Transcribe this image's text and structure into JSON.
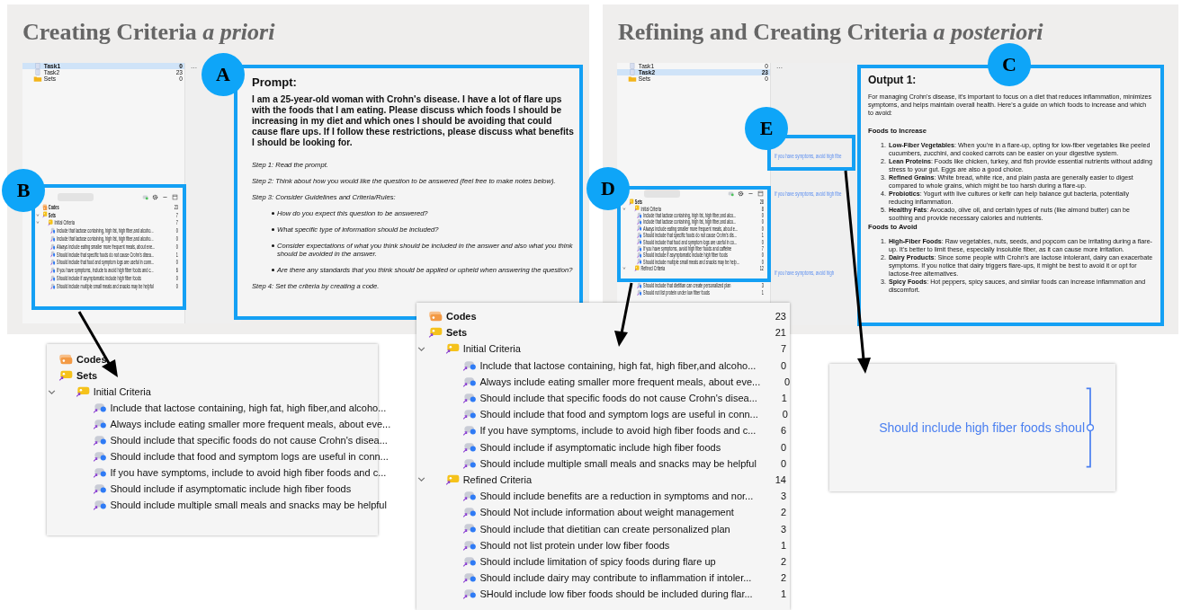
{
  "left_panel": {
    "title": "Creating Criteria *a priori*",
    "document_tree": [
      {
        "label": "Task1",
        "count": "0",
        "kind": "doc",
        "selected": true
      },
      {
        "label": "Task2",
        "count": "23",
        "kind": "doc",
        "selected": false
      },
      {
        "label": "Sets",
        "count": "0",
        "kind": "folder",
        "selected": false
      }
    ],
    "more_glyph": "···",
    "code_system": {
      "callout": "B",
      "rows": [
        {
          "label": "Codes",
          "count": "23",
          "kind": "codes"
        },
        {
          "label": "Sets",
          "count": "7",
          "kind": "set",
          "expanded": true,
          "children": [
            {
              "label": "Initial Criteria",
              "count": "7",
              "kind": "set",
              "expanded": true,
              "children": [
                {
                  "label": "Include that lactose containing, high fat, high fiber,and alcoho...",
                  "count": "0",
                  "kind": "code"
                },
                {
                  "label": "Include that lactose containing, high fat, high fiber,and alcoho...",
                  "count": "0",
                  "kind": "code"
                },
                {
                  "label": "Always include eating smaller more frequent meals, about eve...",
                  "count": "0",
                  "kind": "code"
                },
                {
                  "label": "Should include that specific foods do not cause Crohn's disea...",
                  "count": "1",
                  "kind": "code"
                },
                {
                  "label": "Should include that food and symptom logs are useful in conn...",
                  "count": "0",
                  "kind": "code"
                },
                {
                  "label": "If you have symptoms, include to avoid high fiber foods and c...",
                  "count": "6",
                  "kind": "code"
                },
                {
                  "label": "Should include if asymptomatic include high fiber foods",
                  "count": "0",
                  "kind": "code"
                },
                {
                  "label": "Should include multiple small meals and snacks may be helpful",
                  "count": "0",
                  "kind": "code"
                }
              ]
            }
          ]
        }
      ]
    },
    "prompt": {
      "callout": "A",
      "heading": "Prompt:",
      "question": "I am a 25-year-old woman with Crohn's disease.  I have a lot of flare ups with the foods that I am eating.  Please discuss which foods I should be increasing in my diet and which ones I should be avoiding that could cause flare ups. If I follow these restrictions, please discuss what benefits I should be looking for.",
      "steps": [
        {
          "text": "Step 1: Read the prompt."
        },
        {
          "text": "Step 2: Think about how you would like the question to be answered (feel free to make notes below)."
        },
        {
          "text": "Step 3: Consider Guidelines and Criteria/Rules:",
          "bullets": [
            "How do you expect this question to be answered?",
            "What specific type of information should be included?",
            "Consider expectations of what you think should be included in the answer and also what you think should be avoided in the answer.",
            "Are there any standards that you think should be applied or upheld when answering the question?"
          ]
        },
        {
          "text": "Step 4: Set the criteria by creating a code."
        }
      ]
    }
  },
  "right_panel": {
    "title": "Refining and Creating Criteria *a posteriori*",
    "document_tree": [
      {
        "label": "Task1",
        "count": "0",
        "kind": "doc",
        "selected": false
      },
      {
        "label": "Task2",
        "count": "23",
        "kind": "doc",
        "selected": true
      },
      {
        "label": "Sets",
        "count": "0",
        "kind": "folder",
        "selected": false
      }
    ],
    "more_glyph": "···",
    "code_system": {
      "callout": "D",
      "rows": [
        {
          "label": "Sets",
          "count": "28",
          "kind": "set",
          "children": [
            {
              "label": "Initial Criteria",
              "count": "8",
              "kind": "set",
              "expanded": true,
              "children": [
                {
                  "label": "Include that lactose containing, high fat, high fiber,and alco...",
                  "count": "0",
                  "kind": "code"
                },
                {
                  "label": "Include that lactose containing, high fat, high fiber,and alco...",
                  "count": "0",
                  "kind": "code"
                },
                {
                  "label": "Always include eating smaller more frequent meals, about e...",
                  "count": "0",
                  "kind": "code"
                },
                {
                  "label": "Should include that specific foods do not cause Crohn's dis...",
                  "count": "1",
                  "kind": "code"
                },
                {
                  "label": "Should include that food and symptom logs are useful in co...",
                  "count": "0",
                  "kind": "code"
                },
                {
                  "label": "If you have symptoms, avoid high fiber foods and caffeine",
                  "count": "7",
                  "kind": "code"
                },
                {
                  "label": "Should include if asymptomatic include high fiber foods",
                  "count": "0",
                  "kind": "code"
                },
                {
                  "label": "Should include multiple small meals and snacks may be help...",
                  "count": "0",
                  "kind": "code"
                }
              ]
            },
            {
              "label": "Refined Criteria",
              "count": "12",
              "kind": "set",
              "expanded": true,
              "children": [
                {
                  "label": "Should include that dietitian can create personalized plan",
                  "count": "3",
                  "kind": "code"
                },
                {
                  "label": "Should not list protein under low fiber foods",
                  "count": "1",
                  "kind": "code"
                }
              ]
            }
          ]
        }
      ]
    },
    "segment_callout": "E",
    "segments": [
      "If you have symptoms, avoid high fibe",
      "If you have symptoms, avoid high fibe",
      "If you have symptoms, avoid high"
    ],
    "output": {
      "callout": "C",
      "heading": "Output 1:",
      "intro": "For managing Crohn's disease, it's important to focus on a diet that reduces inflammation, minimizes symptoms, and helps maintain overall health. Here's a guide on which foods to increase and which to avoid:",
      "sections": [
        {
          "heading": "Foods to Increase",
          "items": [
            {
              "number": "1.",
              "text": "**Low-Fiber Vegetables**: When you're in a flare-up, opting for low-fiber vegetables like peeled cucumbers, zucchini, and cooked carrots can be easier on your digestive system."
            },
            {
              "number": "2.",
              "text": "**Lean Proteins**: Foods like chicken, turkey, and fish provide essential nutrients without adding stress to your gut. Eggs are also a good choice."
            },
            {
              "number": "3.",
              "text": "**Refined Grains**: White bread, white rice, and plain pasta are generally easier to digest compared to whole grains, which might be too harsh during a flare-up."
            },
            {
              "number": "4.",
              "text": "**Probiotics**: Yogurt with live cultures or kefir can help balance gut bacteria, potentially reducing inflammation."
            },
            {
              "number": "5.",
              "text": "**Healthy Fats**: Avocado, olive oil, and certain types of nuts (like almond butter) can be soothing and provide necessary calories and nutrients."
            }
          ]
        },
        {
          "heading": "Foods to Avoid",
          "items": [
            {
              "number": "1.",
              "text": "**High-Fiber Foods**: Raw vegetables, nuts, seeds, and popcorn can be irritating during a flare-up. It's better to limit these, especially insoluble fiber, as it can cause more irritation."
            },
            {
              "number": "2.",
              "text": "**Dairy Products**: Since some people with Crohn's are lactose intolerant, dairy can exacerbate symptoms. If you notice that dairy triggers flare-ups, it might be best to avoid it or opt for lactose-free alternatives."
            },
            {
              "number": "3.",
              "text": "**Spicy Foods**: Hot peppers, spicy sauces, and similar foods can increase inflammation and discomfort."
            }
          ]
        }
      ]
    }
  },
  "insets": {
    "b": {
      "rows": [
        {
          "label": "Codes",
          "kind": "codes"
        },
        {
          "label": "Sets",
          "kind": "set",
          "children": [
            {
              "label": "Initial Criteria",
              "kind": "set",
              "expanded": true,
              "children": [
                {
                  "label": "Include that lactose containing, high fat, high fiber,and alcoho...",
                  "kind": "code"
                },
                {
                  "label": "Always include eating smaller more frequent meals, about eve...",
                  "kind": "code"
                },
                {
                  "label": "Should include that specific foods do not cause Crohn's disea...",
                  "kind": "code"
                },
                {
                  "label": "Should include that food and symptom logs are useful in conn...",
                  "kind": "code"
                },
                {
                  "label": "If you have symptoms, include to avoid high fiber foods and c...",
                  "kind": "code"
                },
                {
                  "label": "Should include if asymptomatic include high fiber foods",
                  "kind": "code"
                },
                {
                  "label": "Should include multiple small meals and snacks may be helpful",
                  "kind": "code"
                }
              ]
            }
          ]
        }
      ]
    },
    "d": {
      "rows": [
        {
          "label": "Codes",
          "count": "23",
          "kind": "codes"
        },
        {
          "label": "Sets",
          "count": "21",
          "kind": "set",
          "children": [
            {
              "label": "Initial Criteria",
              "count": "7",
              "kind": "set",
              "expanded": true,
              "children": [
                {
                  "label": "Include that lactose containing, high fat, high fiber,and alcoho...",
                  "count": "0",
                  "kind": "code"
                },
                {
                  "label": "Always include eating smaller more frequent meals, about eve...",
                  "count": "0",
                  "kind": "code"
                },
                {
                  "label": "Should include that specific foods do not cause Crohn's disea...",
                  "count": "1",
                  "kind": "code"
                },
                {
                  "label": "Should include that food and symptom logs are useful in conn...",
                  "count": "0",
                  "kind": "code"
                },
                {
                  "label": "If you have symptoms, include to avoid high fiber foods and c...",
                  "count": "6",
                  "kind": "code"
                },
                {
                  "label": "Should include if asymptomatic include high fiber foods",
                  "count": "0",
                  "kind": "code"
                },
                {
                  "label": "Should include multiple small meals and snacks may be helpful",
                  "count": "0",
                  "kind": "code"
                }
              ]
            },
            {
              "label": "Refined Criteria",
              "count": "14",
              "kind": "set",
              "expanded": true,
              "children": [
                {
                  "label": "Should include benefits are a reduction in symptoms and nor...",
                  "count": "3",
                  "kind": "code"
                },
                {
                  "label": "Should Not include information about weight management",
                  "count": "2",
                  "kind": "code"
                },
                {
                  "label": "Should include that dietitian can create personalized plan",
                  "count": "3",
                  "kind": "code"
                },
                {
                  "label": "Should not list protein under low fiber foods",
                  "count": "1",
                  "kind": "code"
                },
                {
                  "label": "Should include limitation of spicy foods during flare up",
                  "count": "2",
                  "kind": "code"
                },
                {
                  "label": "Should include dairy may contribute to inflammation if intoler...",
                  "count": "2",
                  "kind": "code"
                },
                {
                  "label": "SHould include low fiber foods should be included during flar...",
                  "count": "1",
                  "kind": "code"
                }
              ]
            }
          ]
        }
      ]
    },
    "e": {
      "text": "Should include high fiber foods shoul"
    }
  }
}
